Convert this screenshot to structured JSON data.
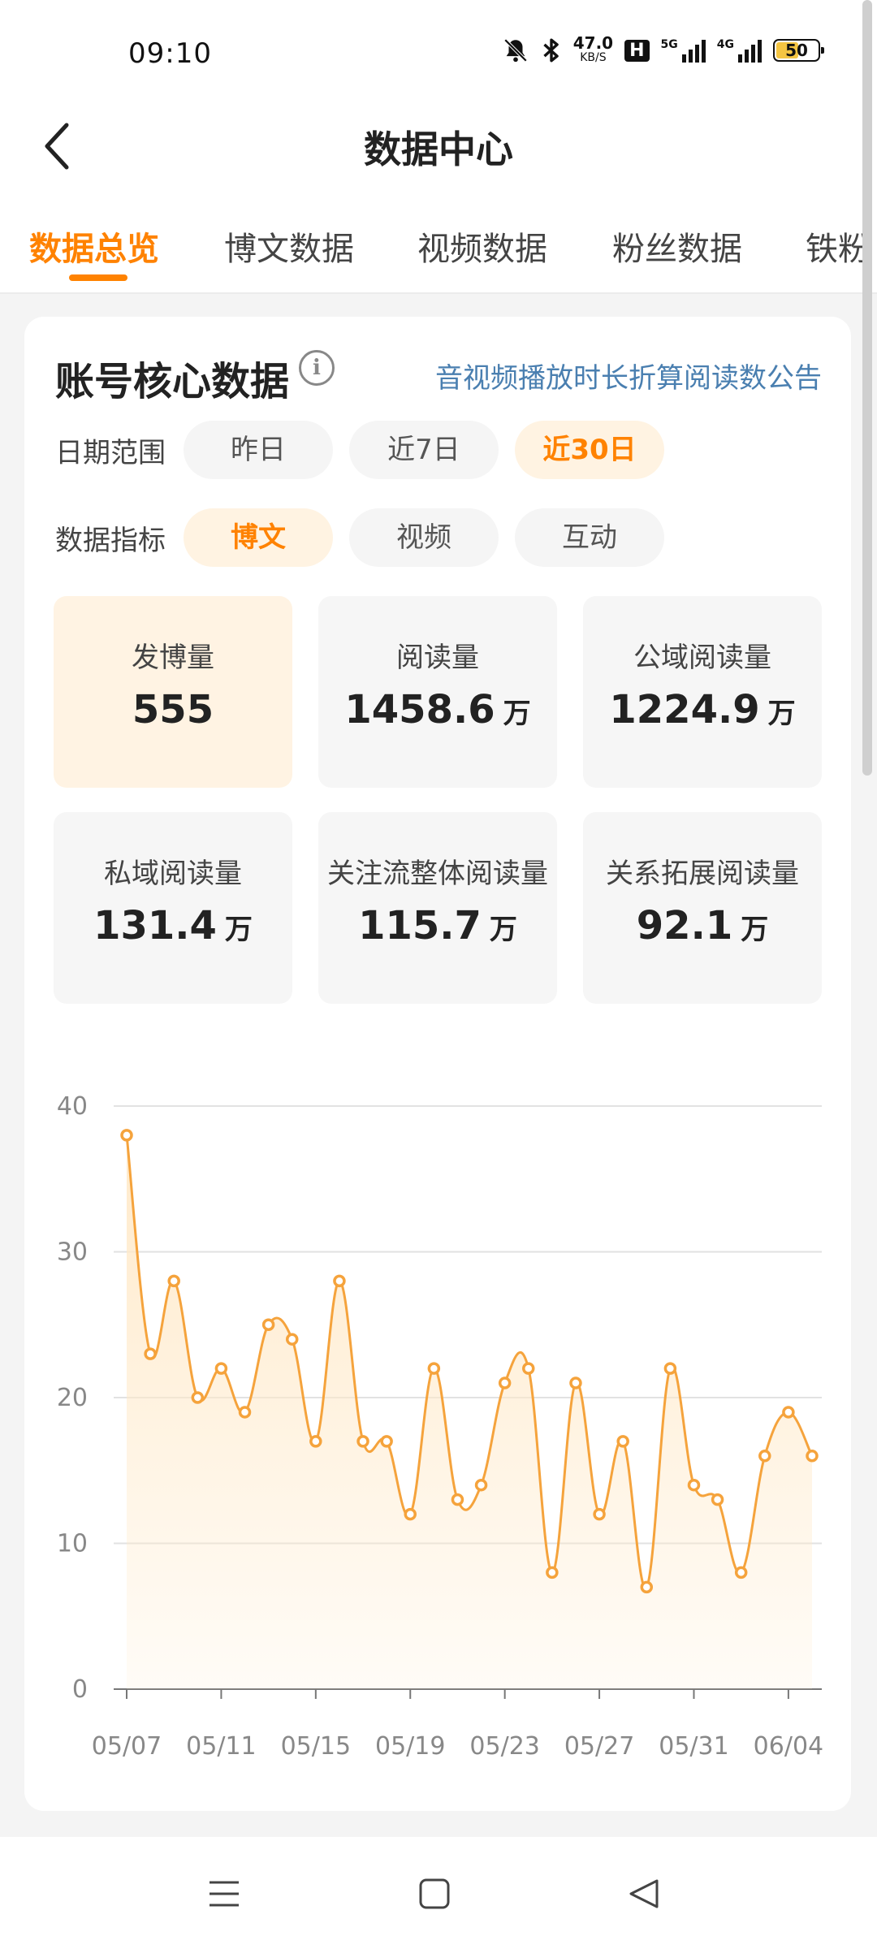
{
  "status_bar": {
    "time": "09:10",
    "net_speed_value": "47.0",
    "net_speed_unit": "KB/S",
    "hd_label": "H",
    "signal1_label": "5G",
    "signal2_label": "4G",
    "battery": "50"
  },
  "header": {
    "title": "数据中心"
  },
  "tabs": [
    {
      "label": "数据总览",
      "active": true
    },
    {
      "label": "博文数据"
    },
    {
      "label": "视频数据"
    },
    {
      "label": "粉丝数据"
    },
    {
      "label": "铁粉"
    }
  ],
  "card": {
    "title": "账号核心数据",
    "info_glyph": "i",
    "notice_link": "音视频播放时长折算阅读数公告",
    "date_range": {
      "label": "日期范围",
      "options": [
        "昨日",
        "近7日",
        "近30日"
      ],
      "selected": "近30日"
    },
    "metric_type": {
      "label": "数据指标",
      "options": [
        "博文",
        "视频",
        "互动"
      ],
      "selected": "博文"
    },
    "metrics": [
      {
        "label": "发博量",
        "value": "555",
        "unit": ""
      },
      {
        "label": "阅读量",
        "value": "1458.6",
        "unit": "万"
      },
      {
        "label": "公域阅读量",
        "value": "1224.9",
        "unit": "万"
      },
      {
        "label": "私域阅读量",
        "value": "131.4",
        "unit": "万"
      },
      {
        "label": "关注流整体阅读量",
        "value": "115.7",
        "unit": "万"
      },
      {
        "label": "关系拓展阅读量",
        "value": "92.1",
        "unit": "万"
      }
    ]
  },
  "chart_data": {
    "type": "area",
    "x": [
      "05/07",
      "05/08",
      "05/09",
      "05/10",
      "05/11",
      "05/12",
      "05/13",
      "05/14",
      "05/15",
      "05/16",
      "05/17",
      "05/18",
      "05/19",
      "05/20",
      "05/21",
      "05/22",
      "05/23",
      "05/24",
      "05/25",
      "05/26",
      "05/27",
      "05/28",
      "05/29",
      "05/30",
      "05/31",
      "06/01",
      "06/02",
      "06/03",
      "06/04",
      "06/05"
    ],
    "values": [
      38,
      23,
      28,
      20,
      22,
      19,
      25,
      24,
      17,
      28,
      17,
      17,
      12,
      22,
      13,
      14,
      21,
      22,
      8,
      21,
      12,
      17,
      7,
      22,
      14,
      13,
      8,
      16,
      19,
      16
    ],
    "x_tick_labels": [
      "05/07",
      "05/11",
      "05/15",
      "05/19",
      "05/23",
      "05/27",
      "05/31",
      "06/04"
    ],
    "y_ticks": [
      0,
      10,
      20,
      30,
      40
    ],
    "ylim": [
      0,
      40
    ],
    "grid": true,
    "line_color": "#f5a33c",
    "fill_color": "#ffe9c8"
  },
  "colors": {
    "accent": "#ff8200",
    "link": "#4a7fb0"
  }
}
